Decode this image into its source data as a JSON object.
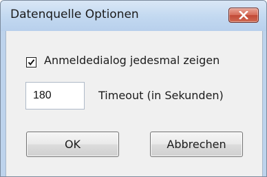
{
  "window": {
    "title": "Datenquelle Optionen"
  },
  "options": {
    "show_login_label": "Anmeldedialog jedesmal zeigen",
    "show_login_checked": true,
    "timeout_value": "180",
    "timeout_label": "Timeout (in Sekunden)"
  },
  "buttons": {
    "ok_label": "OK",
    "cancel_label": "Abbrechen"
  },
  "colors": {
    "title_bar": "#c2d8f0",
    "close_button": "#d66b57",
    "client_background": "#f0f0f0"
  },
  "icons": {
    "close": "close-icon",
    "check": "checkmark-icon"
  }
}
